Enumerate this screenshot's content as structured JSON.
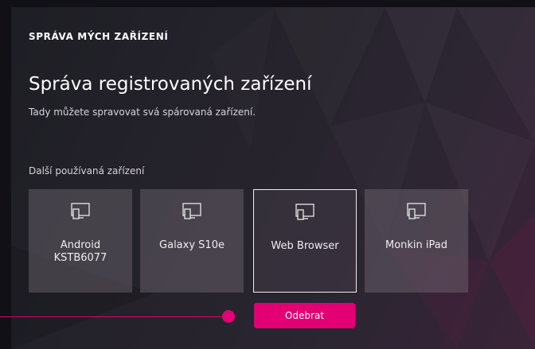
{
  "header": {
    "section_title": "SPRÁVA MÝCH ZAŘÍZENÍ",
    "heading": "Správa registrovaných zařízení",
    "subtitle": "Tady můžete spravovat svá spárovaná zařízení."
  },
  "devices": {
    "label": "Další používaná zařízení",
    "items": [
      {
        "label": "Android\nKSTB6077",
        "icon": "device-icon",
        "selected": false
      },
      {
        "label": "Galaxy S10e",
        "icon": "device-icon",
        "selected": false
      },
      {
        "label": "Web Browser",
        "icon": "device-icon",
        "selected": true
      },
      {
        "label": "Monkin iPad",
        "icon": "device-icon",
        "selected": false
      }
    ]
  },
  "actions": {
    "remove_label": "Odebrat"
  },
  "colors": {
    "accent": "#e20074",
    "background": "#22212a",
    "tile": "#5a5460"
  }
}
